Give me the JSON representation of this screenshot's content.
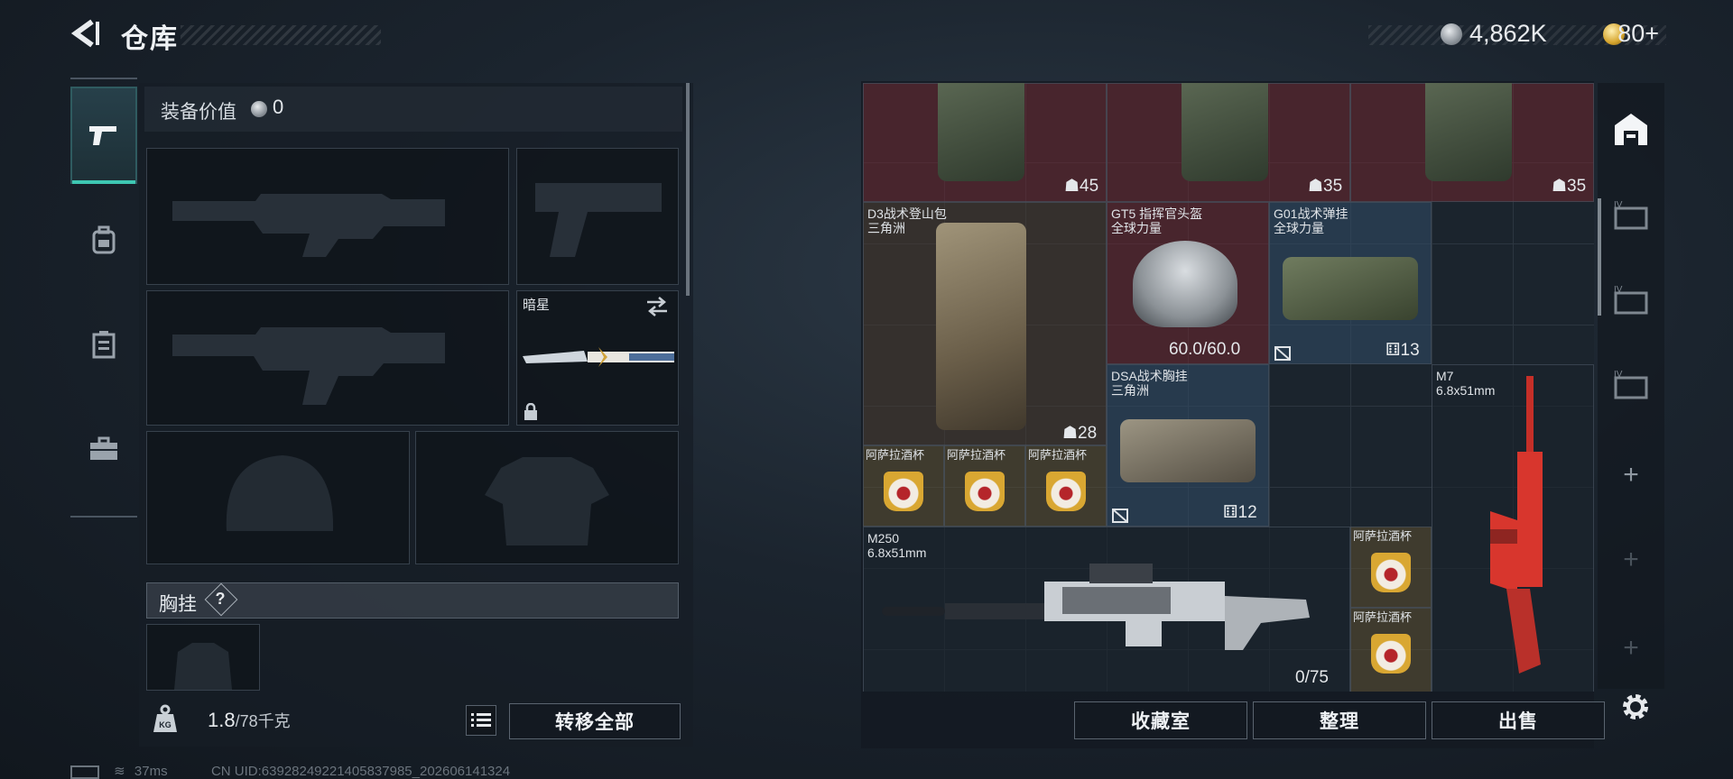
{
  "header": {
    "title": "仓库",
    "money": "4,862K",
    "tickets": "80+"
  },
  "nav": {
    "items": [
      "weapons-icon",
      "backpack-icon",
      "vest-icon",
      "briefcase-icon"
    ],
    "active": 0
  },
  "loadout": {
    "equip_value_label": "装备价值",
    "equip_value": "0",
    "melee_name": "暗星",
    "chest_rig_label": "胸挂",
    "help_glyph": "?",
    "weight_current": "1.8",
    "weight_max": "/78千克",
    "transfer_all": "转移全部"
  },
  "storage": {
    "top_items": [
      {
        "value": "45"
      },
      {
        "value": "35"
      },
      {
        "value": "35"
      }
    ],
    "items": [
      {
        "name": "D3战术登山包",
        "sub": "三角洲",
        "value": "28"
      },
      {
        "name": "GT5 指挥官头盔",
        "sub": "全球力量",
        "value": "60.0/60.0"
      },
      {
        "name": "G01战术弹挂",
        "sub": "全球力量",
        "value": "13"
      },
      {
        "name": "DSA战术胸挂",
        "sub": "三角洲",
        "value": "12"
      },
      {
        "name": "M7",
        "sub": "6.8x51mm"
      },
      {
        "name": "M250",
        "sub": "6.8x51mm",
        "value": "0/75"
      }
    ],
    "cups": [
      "阿萨拉酒杯",
      "阿萨拉酒杯",
      "阿萨拉酒杯",
      "阿萨拉酒杯",
      "阿萨拉酒杯"
    ],
    "buttons": {
      "collection": "收藏室",
      "sort": "整理",
      "sell": "出售"
    }
  },
  "status": {
    "ping": "37ms",
    "uid": "CN UID:6392824922140583798​5_202606141324"
  },
  "colors": {
    "accent": "#3ec7b2",
    "red_slot": "#6e262d",
    "blue_slot": "#304a62",
    "weapon_red": "#d8362d"
  }
}
